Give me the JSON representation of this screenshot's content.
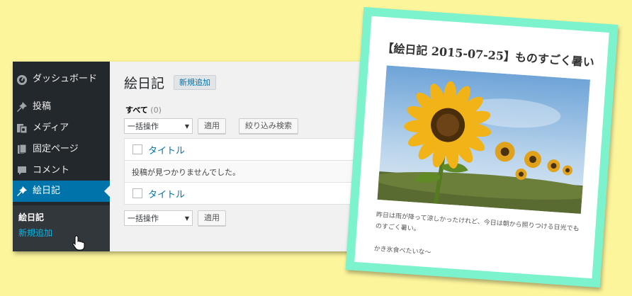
{
  "admin_menu": {
    "items": [
      {
        "label": "ダッシュボード",
        "icon": "dashboard-icon"
      },
      {
        "label": "投稿",
        "icon": "pin-icon"
      },
      {
        "label": "メディア",
        "icon": "media-icon"
      },
      {
        "label": "固定ページ",
        "icon": "page-icon"
      },
      {
        "label": "コメント",
        "icon": "comment-icon"
      },
      {
        "label": "絵日記",
        "icon": "pin-icon"
      }
    ],
    "submenu": {
      "current": "絵日記",
      "add_new": "新規追加"
    },
    "colors": {
      "bg": "#23282d",
      "active": "#0073aa",
      "submenu_bg": "#32373c"
    }
  },
  "content": {
    "title": "絵日記",
    "add_new_button": "新規追加",
    "filter": {
      "all_label": "すべて",
      "count": "(0)"
    },
    "bulk_action": "一括操作",
    "apply_button": "適用",
    "filter_button": "絞り込み検索",
    "table": {
      "header_title": "タイトル",
      "empty_message": "投稿が見つかりませんでした。",
      "footer_title": "タイトル"
    }
  },
  "post": {
    "title": "【絵日記 2015-07-25】ものすごく暑い",
    "body": "昨日は雨が降って涼しかったけれど、今日は朝から照りつける日光でものすごく暑い。",
    "closing": "かき氷食べたいな～",
    "frame_color": "#7cf3cd"
  },
  "background_color": "#fdf59b"
}
